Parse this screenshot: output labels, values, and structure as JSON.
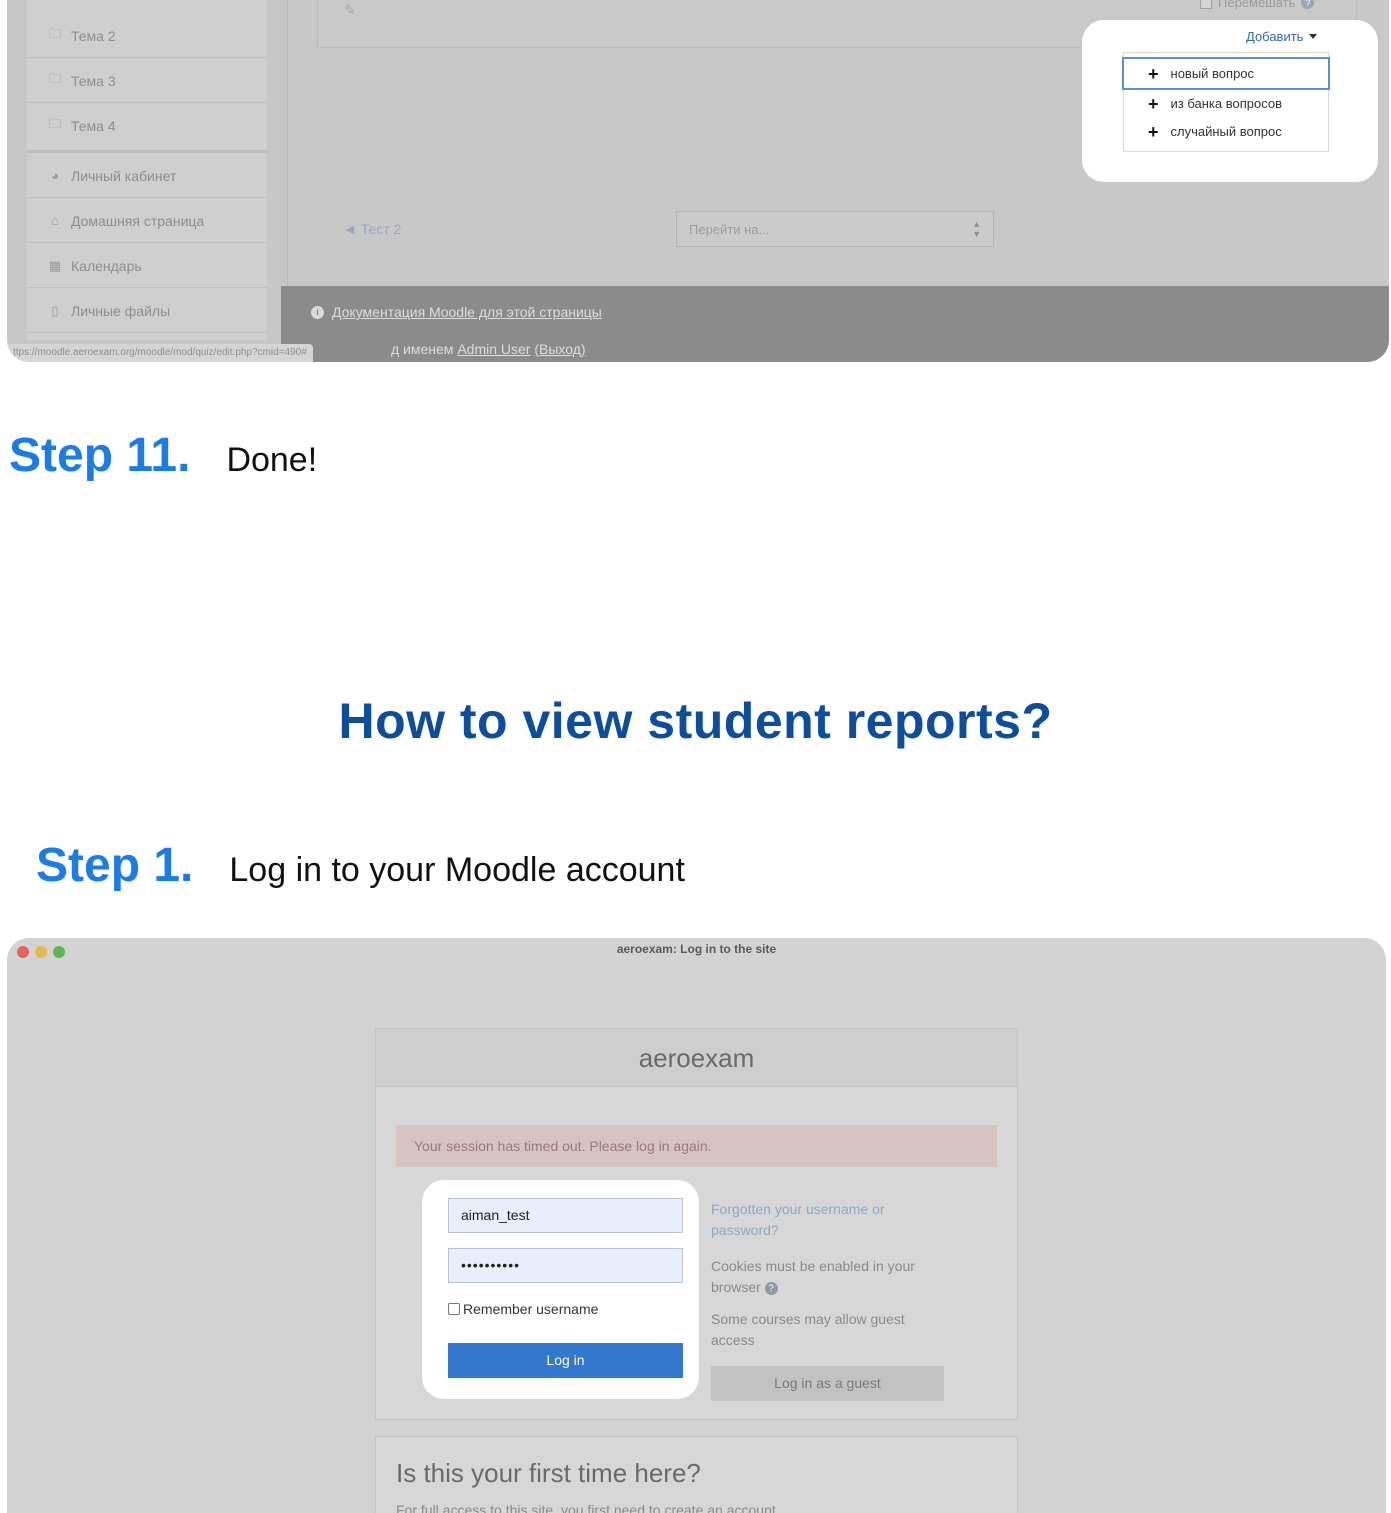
{
  "moodle_editor": {
    "sidebar": [
      {
        "icon": "folder-icon",
        "glyph": "🗀",
        "label": "Тема 2"
      },
      {
        "icon": "folder-icon",
        "glyph": "🗀",
        "label": "Тема 3"
      },
      {
        "icon": "folder-icon",
        "glyph": "🗀",
        "label": "Тема 4"
      },
      {
        "icon": "dashboard-icon",
        "glyph": "◕",
        "label": "Личный кабинет"
      },
      {
        "icon": "home-icon",
        "glyph": "⌂",
        "label": "Домашняя страница"
      },
      {
        "icon": "calendar-icon",
        "glyph": "▦",
        "label": "Календарь"
      },
      {
        "icon": "file-icon",
        "glyph": "▯",
        "label": "Личные файлы"
      }
    ],
    "shuffle_label": "Перемешать",
    "help_glyph": "?",
    "add_label": "Добавить",
    "add_menu": [
      "новый вопрос",
      "из банка вопросов",
      "случайный вопрос"
    ],
    "prev_link": "◄ Тест 2",
    "jump_placeholder": "Перейти на...",
    "doc_link": "Документация Moodle для этой страницы",
    "logged_in_prefix": "д именем ",
    "logged_in_user": "Admin User",
    "logout_label": "(Выход)",
    "status_url": "ttps://moodle.aeroexam.org/moodle/mod/quiz/edit.php?cmid=490#"
  },
  "step11": {
    "number": "Step 11.",
    "text": "Done!"
  },
  "section_title": "How to view student reports?",
  "step1": {
    "number": "Step 1.",
    "text": "Log in to your Moodle account"
  },
  "login_window": {
    "window_title": "aeroexam: Log in to the site",
    "site_name": "aeroexam",
    "alert": "Your session has timed out. Please log in again.",
    "username_value": "aiman_test",
    "password_value": "••••••••••",
    "remember_label": "Remember username",
    "login_button": "Log in",
    "forgot_link": "Forgotten your username or password?",
    "cookies_text": "Cookies must be enabled in your browser",
    "guest_info": "Some courses may allow guest access",
    "guest_button": "Log in as a guest",
    "first_time_title": "Is this your first time here?",
    "first_time_text": "For full access to this site, you first need to create an account."
  },
  "colors": {
    "step_number": "#1c7ce5",
    "section_title": "#0c4d9e",
    "login_button": "#3378cc"
  }
}
